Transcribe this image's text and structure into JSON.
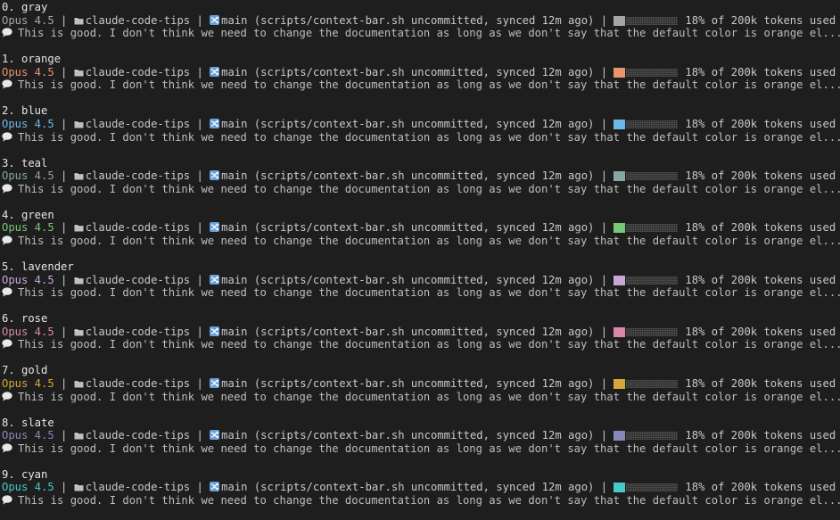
{
  "statusline": {
    "model": "Opus 4.5",
    "separator": "|",
    "folder_icon": "folder-icon",
    "repo": "claude-code-tips",
    "branch_icon": "git-branch-icon",
    "branch": "main",
    "branch_detail": "(scripts/context-bar.sh uncommitted, synced 12m ago)",
    "progress_fraction": 0.18,
    "usage_text": "18% of 200k tokens used",
    "chat_icon": "speech-bubble-icon",
    "message": "This is good. I don't think we need to change the documentation as long as we don't say that the default color is orange el..."
  },
  "themes": [
    {
      "title": "0. gray",
      "color": "#a6a6a6",
      "model_color": "#a6a6a6"
    },
    {
      "title": "1. orange",
      "color": "#e8946c",
      "model_color": "#e8946c"
    },
    {
      "title": "2. blue",
      "color": "#6cb8e8",
      "model_color": "#6cb8e8"
    },
    {
      "title": "3. teal",
      "color": "#86a8a4",
      "model_color": "#86a8a4"
    },
    {
      "title": "4. green",
      "color": "#78c878",
      "model_color": "#78c878"
    },
    {
      "title": "5. lavender",
      "color": "#c8a8d8",
      "model_color": "#c8a8d8"
    },
    {
      "title": "6. rose",
      "color": "#d888a8",
      "model_color": "#d888a8"
    },
    {
      "title": "7. gold",
      "color": "#d4a838",
      "model_color": "#d4a838"
    },
    {
      "title": "8. slate",
      "color": "#8888b8",
      "model_color": "#8888b8"
    },
    {
      "title": "9. cyan",
      "color": "#48c8c8",
      "model_color": "#48c8c8"
    }
  ]
}
